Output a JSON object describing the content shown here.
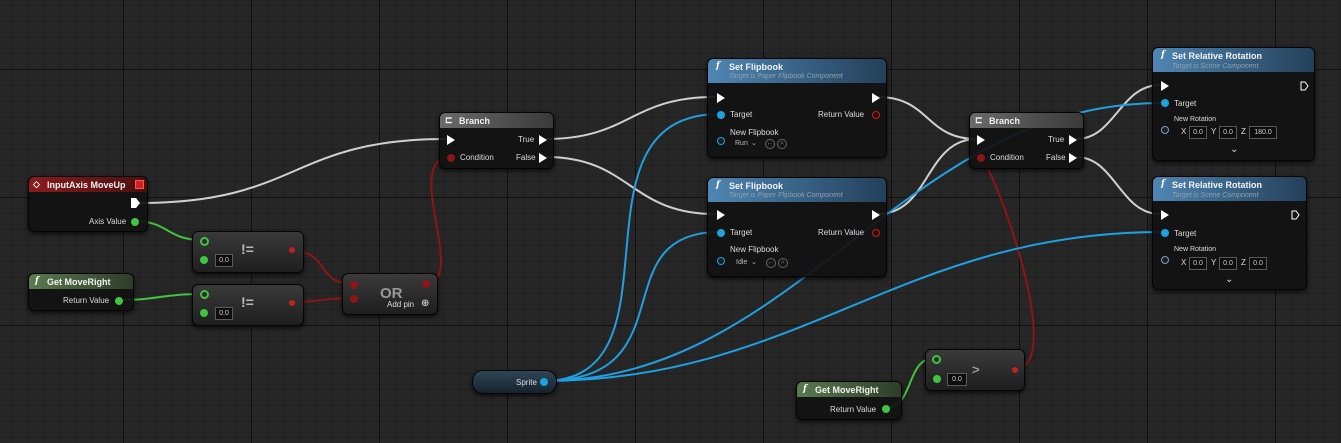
{
  "colors": {
    "exec": "#ffffff",
    "bool": "#8c1515",
    "float": "#3fc53f",
    "object": "#1fa0e0",
    "struct": "#7a9ed2",
    "event_header": "#8a1b1b",
    "func_header": "#4e86b3",
    "pure_header": "#4f6b46",
    "branch_header": "#5a5a5a"
  },
  "nodes": {
    "input_axis": {
      "icon": "diamond-icon",
      "title": "InputAxis MoveUp",
      "pin_axis": "Axis Value"
    },
    "get_moveright_1": {
      "icon": "function-icon",
      "title": "Get MoveRight",
      "pin_return": "Return Value"
    },
    "get_moveright_2": {
      "icon": "function-icon",
      "title": "Get MoveRight",
      "pin_return": "Return Value"
    },
    "neq_1": {
      "op": "!=",
      "value": "0.0"
    },
    "neq_2": {
      "op": "!=",
      "value": "0.0"
    },
    "or": {
      "op": "OR",
      "add_pin": "Add pin"
    },
    "branch_1": {
      "icon": "branch-icon",
      "title": "Branch",
      "true": "True",
      "false": "False",
      "condition": "Condition"
    },
    "branch_2": {
      "icon": "branch-icon",
      "title": "Branch",
      "true": "True",
      "false": "False",
      "condition": "Condition"
    },
    "set_flipbook_run": {
      "title": "Set Flipbook",
      "subtitle": "Target is Paper Flipbook Component",
      "target": "Target",
      "return": "Return Value",
      "new_flipbook": "New Flipbook",
      "value": "Run"
    },
    "set_flipbook_idle": {
      "title": "Set Flipbook",
      "subtitle": "Target is Paper Flipbook Component",
      "target": "Target",
      "return": "Return Value",
      "new_flipbook": "New Flipbook",
      "value": "Idle"
    },
    "set_rot_1": {
      "title": "Set Relative Rotation",
      "subtitle": "Target is Scene Component",
      "target": "Target",
      "new_rotation": "New Rotation",
      "x_label": "X",
      "y_label": "Y",
      "z_label": "Z",
      "x": "0.0",
      "y": "0.0",
      "z": "180.0"
    },
    "set_rot_2": {
      "title": "Set Relative Rotation",
      "subtitle": "Target is Scene Component",
      "target": "Target",
      "new_rotation": "New Rotation",
      "x_label": "X",
      "y_label": "Y",
      "z_label": "Z",
      "x": "0.0",
      "y": "0.0",
      "z": "0.0"
    },
    "sprite": {
      "label": "Sprite"
    },
    "gt": {
      "op": ">",
      "value": "0.0"
    }
  }
}
